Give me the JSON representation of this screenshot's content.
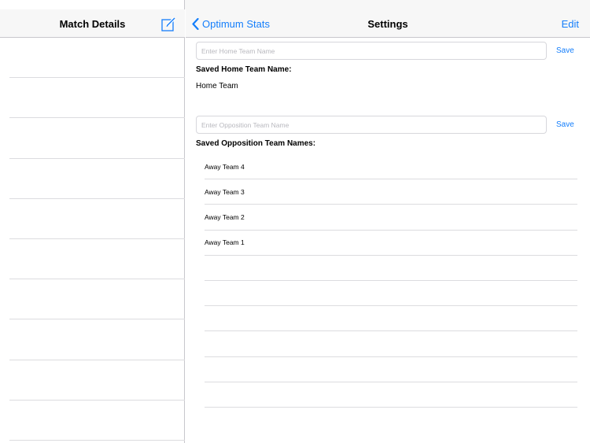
{
  "sidebar": {
    "title": "Match Details",
    "compose_icon": "compose-icon",
    "row_count": 10
  },
  "header": {
    "back_label": "Optimum Stats",
    "title": "Settings",
    "edit_label": "Edit"
  },
  "home": {
    "placeholder": "Enter Home Team Name",
    "save_label": "Save",
    "saved_heading": "Saved Home Team Name:",
    "saved_name": "Home Team"
  },
  "opposition": {
    "placeholder": "Enter Opposition Team Name",
    "save_label": "Save",
    "saved_heading": "Saved Opposition Team Names:",
    "teams": [
      "Away Team 4",
      "Away Team 3",
      "Away Team 2",
      "Away Team 1",
      "",
      "",
      "",
      "",
      "",
      ""
    ]
  },
  "colors": {
    "accent": "#147efb",
    "nav_background": "#f7f7f7",
    "separator": "#dcdcdf"
  }
}
